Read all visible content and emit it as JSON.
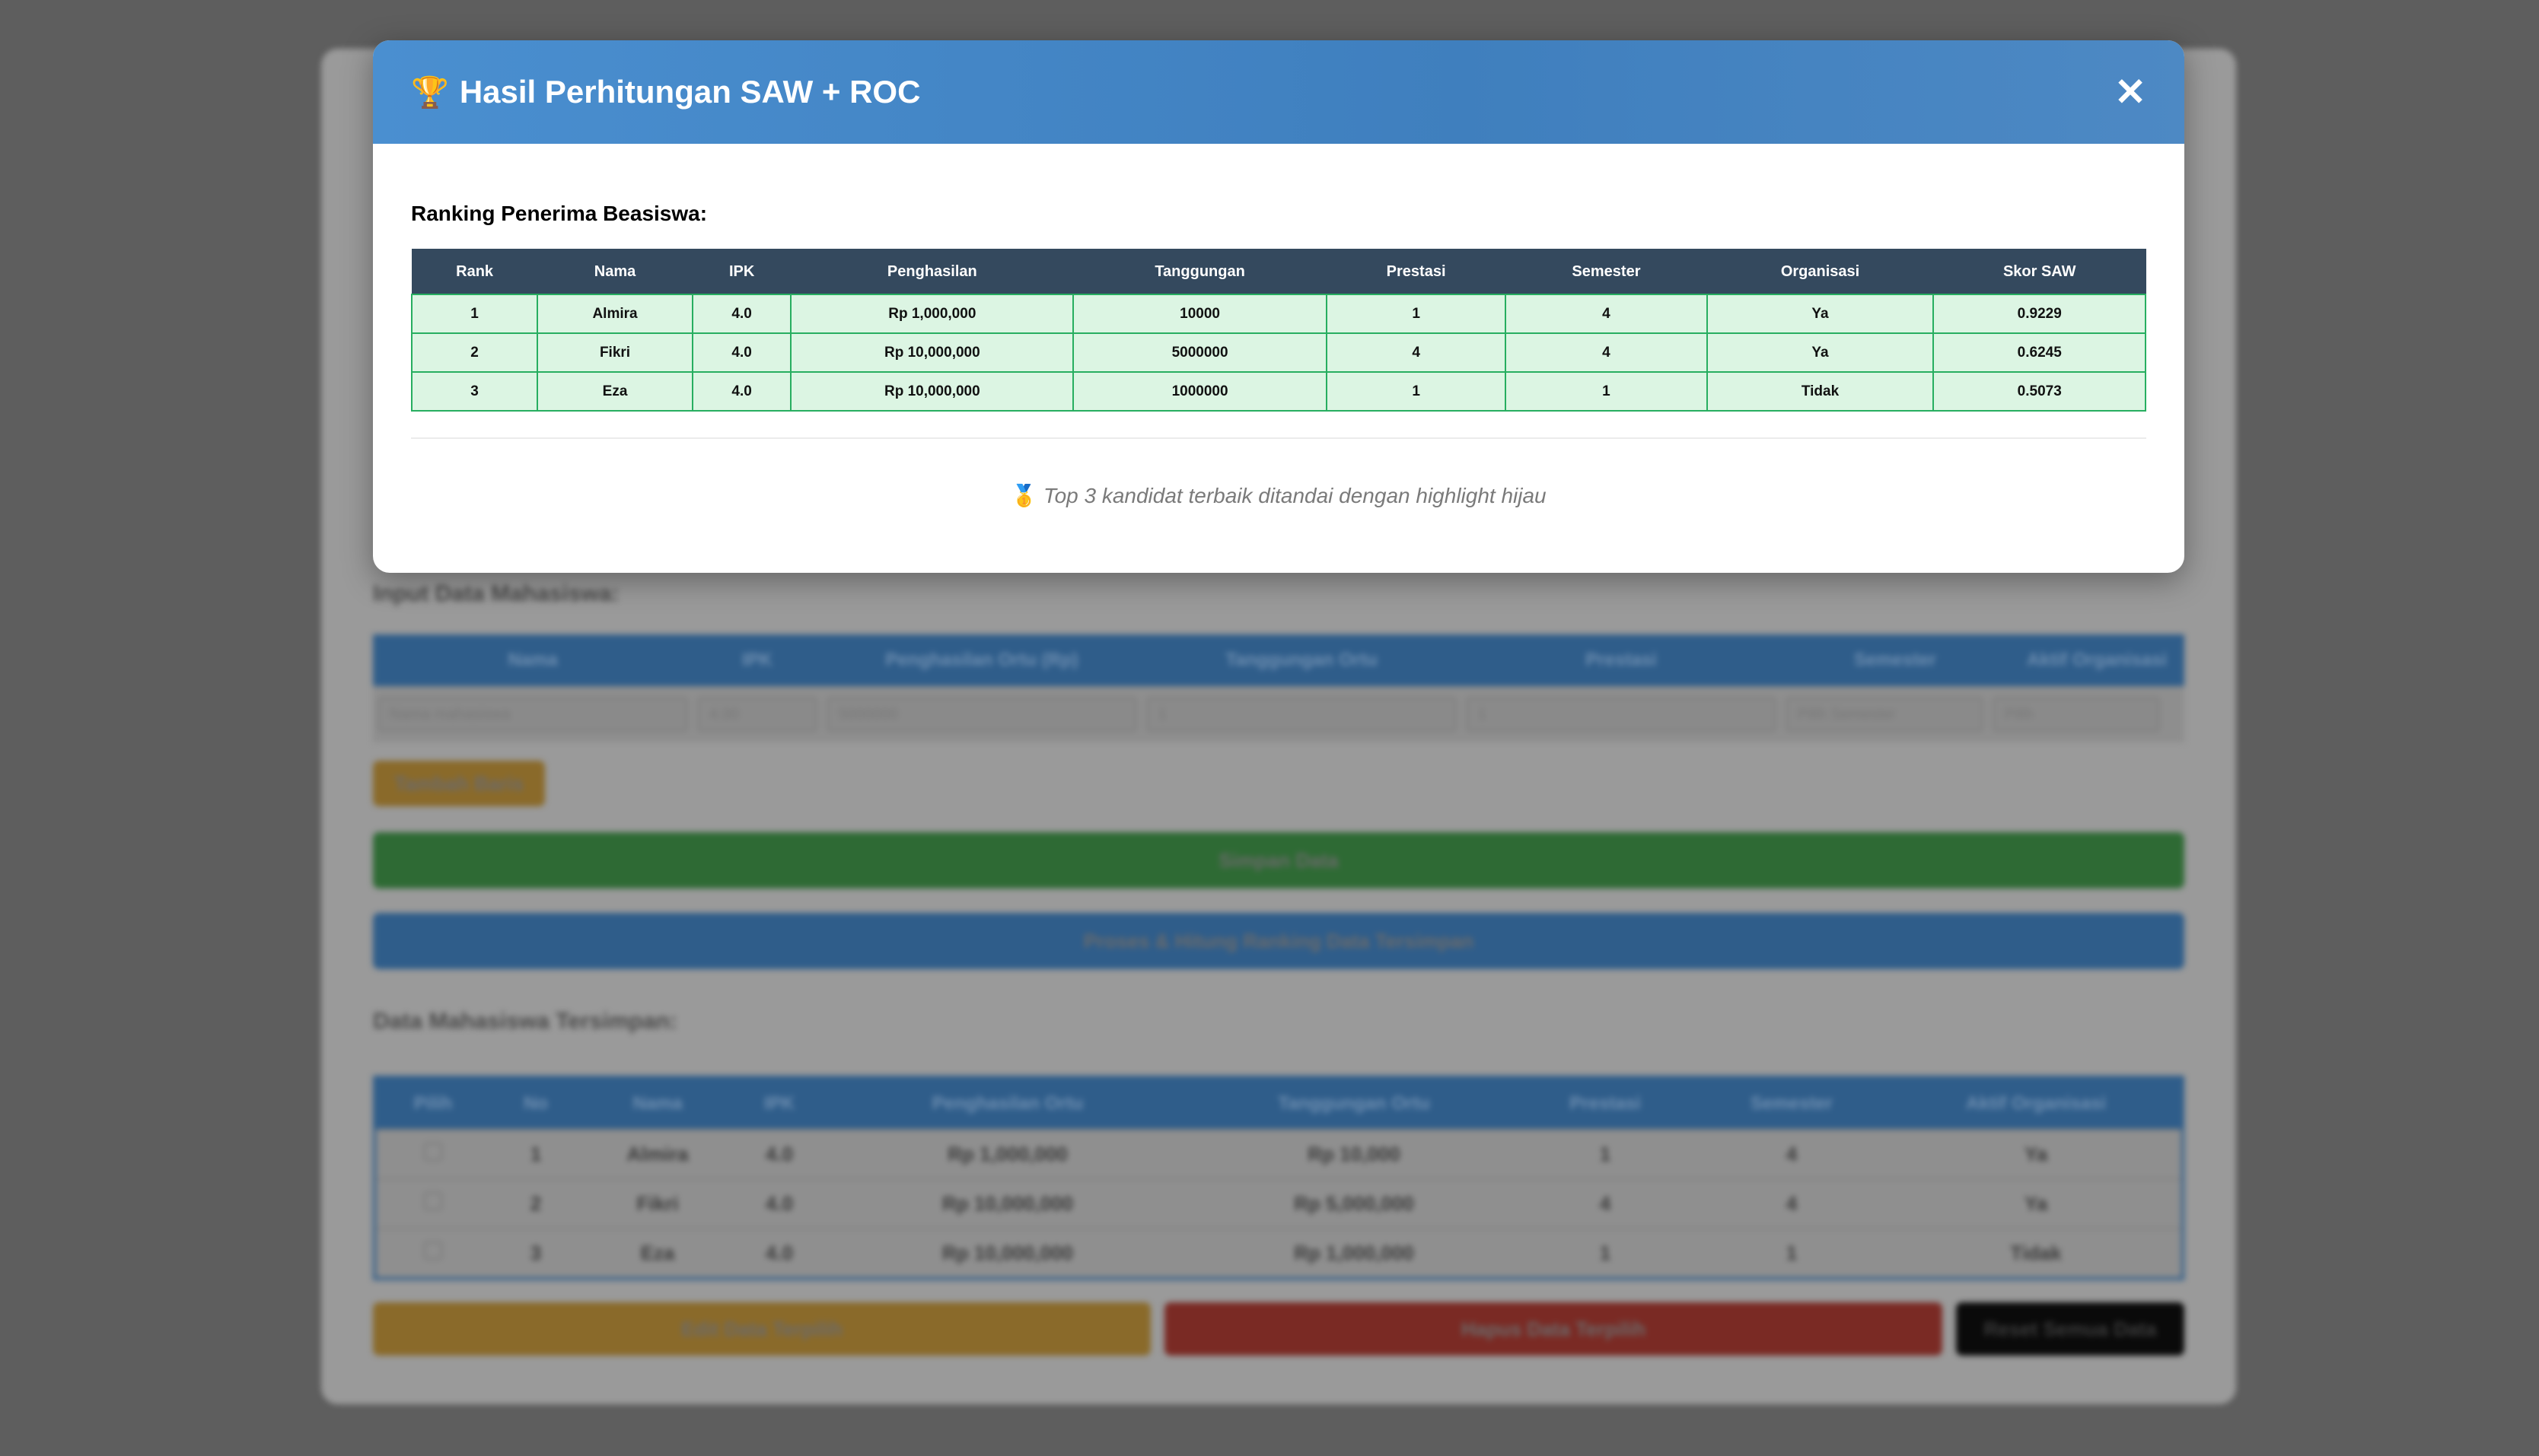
{
  "modal": {
    "title": "Hasil Perhitungan SAW + ROC",
    "trophy_icon": "🏆",
    "close_icon": "✕",
    "ranking_heading": "Ranking Penerima Beasiswa:",
    "columns": [
      "Rank",
      "Nama",
      "IPK",
      "Penghasilan",
      "Tanggungan",
      "Prestasi",
      "Semester",
      "Organisasi",
      "Skor SAW"
    ],
    "rows": [
      [
        "1",
        "Almira",
        "4.0",
        "Rp 1,000,000",
        "10000",
        "1",
        "4",
        "Ya",
        "0.9229"
      ],
      [
        "2",
        "Fikri",
        "4.0",
        "Rp 10,000,000",
        "5000000",
        "4",
        "4",
        "Ya",
        "0.6245"
      ],
      [
        "3",
        "Eza",
        "4.0",
        "Rp 10,000,000",
        "1000000",
        "1",
        "1",
        "Tidak",
        "0.5073"
      ]
    ],
    "medal_icon": "🥇",
    "footnote": "Top 3 kandidat terbaik ditandai dengan highlight hijau",
    "highlight_color": "#dcf5e3",
    "header_color": "#34495e"
  },
  "background": {
    "input_heading": "Input Data Mahasiswa:",
    "input_columns": [
      "Nama",
      "IPK",
      "Penghasilan Ortu (Rp)",
      "Tanggungan Ortu",
      "Prestasi",
      "Semester",
      "Aktif Organisasi"
    ],
    "input_placeholders": {
      "nama": "Nama mahasiswa",
      "ipk": "4.00",
      "penghasilan": "5000000",
      "tanggungan": "1",
      "prestasi": "1",
      "semester": "Pilih Semester",
      "organisasi": "Pilih"
    },
    "add_row_label": "Tambah Baris",
    "save_label": "Simpan Data",
    "process_label": "Proses & Hitung Ranking Data Tersimpan",
    "saved_heading": "Data Mahasiswa Tersimpan:",
    "saved_columns": [
      "Pilih",
      "No",
      "Nama",
      "IPK",
      "Penghasilan Ortu",
      "Tanggungan Ortu",
      "Prestasi",
      "Semester",
      "Aktif Organisasi"
    ],
    "saved_rows": [
      [
        "1",
        "Almira",
        "4.0",
        "Rp 1,000,000",
        "Rp 10,000",
        "1",
        "4",
        "Ya"
      ],
      [
        "2",
        "Fikri",
        "4.0",
        "Rp 10,000,000",
        "Rp 5,000,000",
        "4",
        "4",
        "Ya"
      ],
      [
        "3",
        "Eza",
        "4.0",
        "Rp 10,000,000",
        "Rp 1,000,000",
        "1",
        "1",
        "Tidak"
      ]
    ],
    "edit_label": "Edit Data Terpilih",
    "delete_label": "Hapus Data Terpilih",
    "reset_label": "Reset Semua Data"
  }
}
